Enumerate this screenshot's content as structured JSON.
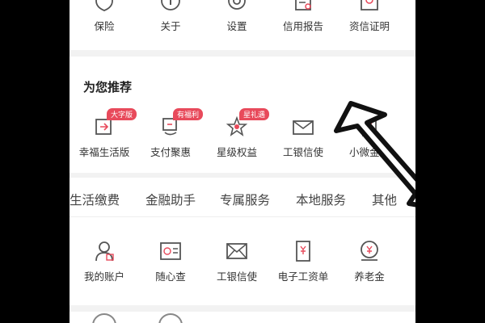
{
  "top_row": [
    {
      "label": "保险",
      "icon": "shield-icon"
    },
    {
      "label": "关于",
      "icon": "info-icon"
    },
    {
      "label": "设置",
      "icon": "gear-icon"
    },
    {
      "label": "信用报告",
      "icon": "report-icon"
    },
    {
      "label": "资信证明",
      "icon": "certificate-icon"
    }
  ],
  "recommend": {
    "title": "为您推荐",
    "items": [
      {
        "label": "幸福生活版",
        "badge": "大字版",
        "icon": "happy-life-icon"
      },
      {
        "label": "支付聚惠",
        "badge": "有福利",
        "icon": "pay-discount-icon"
      },
      {
        "label": "星级权益",
        "badge": "星礼遇",
        "icon": "star-rights-icon"
      },
      {
        "label": "工银信使",
        "badge": "",
        "icon": "envelope-icon"
      },
      {
        "label": "小微金融",
        "badge": "",
        "icon": "small-finance-icon"
      }
    ]
  },
  "tabs": [
    "生活缴费",
    "金融助手",
    "专属服务",
    "本地服务",
    "其他"
  ],
  "other_row": [
    {
      "label": "我的账户",
      "icon": "account-icon"
    },
    {
      "label": "随心查",
      "icon": "query-icon"
    },
    {
      "label": "工银信使",
      "icon": "envelope-icon"
    },
    {
      "label": "电子工资单",
      "icon": "payslip-icon"
    },
    {
      "label": "养老金",
      "icon": "pension-icon"
    }
  ],
  "colors": {
    "accent": "#e84a5b",
    "icon_stroke": "#555555",
    "page_bg": "#ffffff",
    "letterbox": "#000000"
  }
}
